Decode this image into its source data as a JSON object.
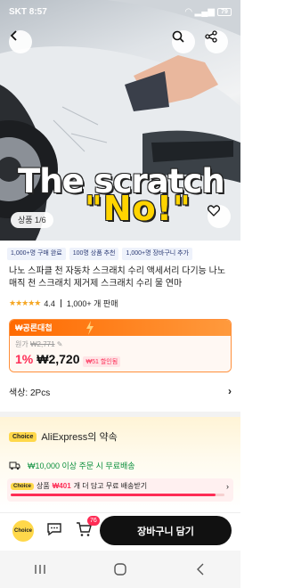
{
  "status_bar": {
    "time": "8:57",
    "carrier": "SKT",
    "battery": "79"
  },
  "hero": {
    "overlay_line1": "The scratch",
    "overlay_line2": "\"No!\"",
    "counter": "상품 1/6"
  },
  "tags": [
    "1,000+명 구매 완료",
    "100명 상품 추천",
    "1,000+명 장바구니 추가"
  ],
  "product": {
    "title": "나노 스파클 천 자동차 스크래치 수리 액세서리 다기능 나노 매직 천 스크래치 제거제 스크래치 수리 물 연마",
    "rating": "4.4",
    "sold": "1,000+ 개 판매"
  },
  "deal": {
    "label": "₩공론대첩",
    "original_label": "원가",
    "original_price": "₩2,771",
    "discount_pct": "1%",
    "price": "₩2,720",
    "coupon": "₩51 할인됨"
  },
  "option": {
    "label": "색상: 2Pcs"
  },
  "choice": {
    "badge": "Choice",
    "title": "AliExpress의 약속",
    "shipping": "₩10,000 이상 주문 시 무료배송",
    "progress_prefix": "상품",
    "progress_amount": "₩401",
    "progress_suffix": "개 더 담고 무료 배송받기",
    "progress_fraction": 0.96
  },
  "bottom_bar": {
    "choice_label": "Choice",
    "cart_count": "76",
    "add_to_cart": "장바구니 담기"
  },
  "colors": {
    "accent": "#fe2c55",
    "deal_orange": "#ff6a00",
    "choice_yellow": "#ffd84a",
    "free_ship_green": "#0a8f3c"
  }
}
